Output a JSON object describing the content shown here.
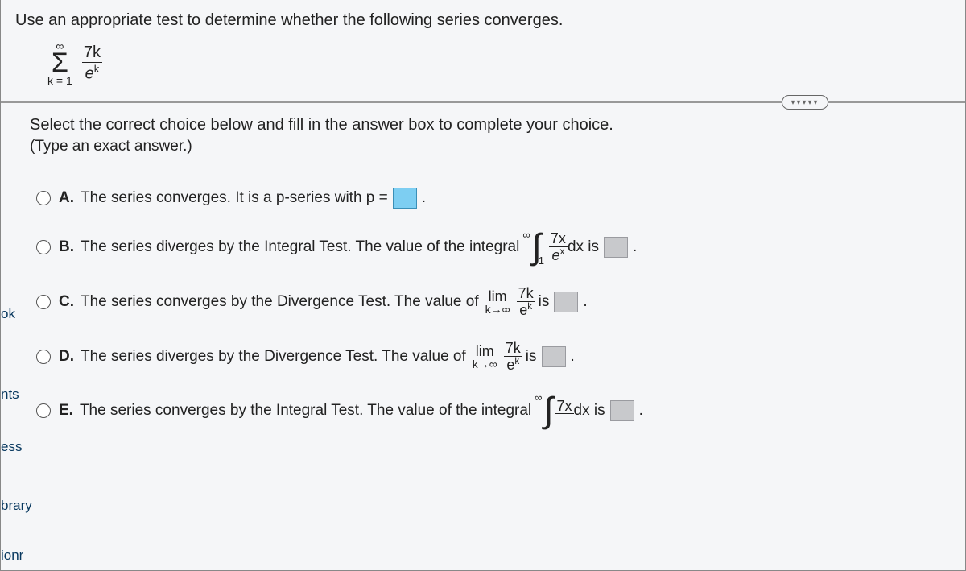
{
  "prompt": "Use an appropriate test to determine whether the following series converges.",
  "series": {
    "top": "∞",
    "symbol": "Σ",
    "bottom": "k = 1",
    "frac_num": "7k",
    "frac_den_base": "e",
    "frac_den_exp": "k"
  },
  "toggle_dots": "▾▾▾▾▾",
  "instruct": "Select the correct choice below and fill in the answer box to complete your choice.",
  "instruct_sub": "(Type an exact answer.)",
  "options": {
    "a": {
      "letter": "A.",
      "text": "The series converges. It is a p-series with p =",
      "period": "."
    },
    "b": {
      "letter": "B.",
      "text": "The series diverges by the Integral Test. The value of the integral",
      "int_top": "∞",
      "int_bot": "1",
      "frac_num": "7x",
      "frac_den_base": "e",
      "frac_den_exp": "x",
      "dx": "dx is",
      "period": "."
    },
    "c": {
      "letter": "C.",
      "text": "The series converges by the Divergence Test. The value of",
      "lim": "lim",
      "lim_sub": "k→∞",
      "frac_num": "7k",
      "frac_den_base": "e",
      "frac_den_exp": "k",
      "is": "is",
      "period": "."
    },
    "d": {
      "letter": "D.",
      "text": "The series diverges by the Divergence Test. The value of",
      "lim": "lim",
      "lim_sub": "k→∞",
      "frac_num": "7k",
      "frac_den_base": "e",
      "frac_den_exp": "k",
      "is": "is",
      "period": "."
    },
    "e": {
      "letter": "E.",
      "text": "The series converges by the Integral Test. The value of the integral",
      "int_top": "∞",
      "frac_num": "7x",
      "dx": "dx is",
      "period": "."
    }
  },
  "side": {
    "s1": "ok",
    "s2": "nts",
    "s3": "ess",
    "s4": "brary",
    "s5": "ionr"
  }
}
